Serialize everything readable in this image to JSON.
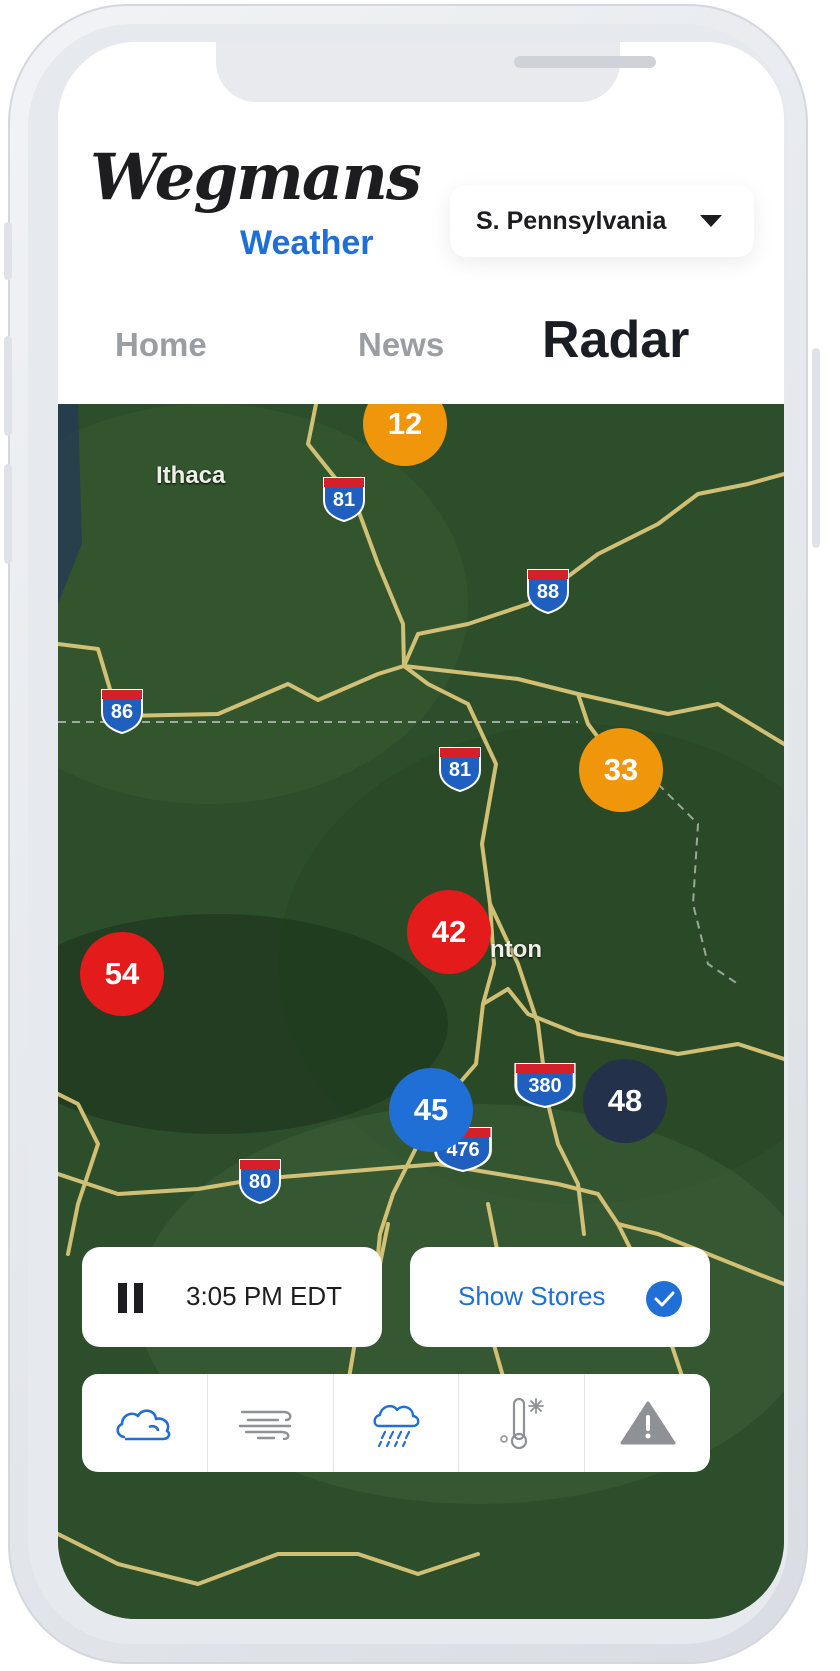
{
  "app": {
    "brand": "Wegmans",
    "brand_sub": "Weather"
  },
  "region_select": {
    "value": "S. Pennsylvania"
  },
  "tabs": [
    {
      "label": "Home"
    },
    {
      "label": "News"
    },
    {
      "label": "Radar",
      "active": true
    }
  ],
  "map": {
    "city": "Ithaca",
    "city_partial": "nton",
    "interstates": [
      "81",
      "88",
      "86",
      "81",
      "380",
      "476",
      "80"
    ],
    "markers": [
      {
        "value": "12",
        "color": "#f0960b"
      },
      {
        "value": "33",
        "color": "#f0960b"
      },
      {
        "value": "42",
        "color": "#e41b1b"
      },
      {
        "value": "54",
        "color": "#e41b1b"
      },
      {
        "value": "45",
        "color": "#1f6fd6"
      },
      {
        "value": "48",
        "color": "#23324a"
      }
    ]
  },
  "playback": {
    "time": "3:05 PM EDT"
  },
  "stores_toggle": {
    "label": "Show Stores",
    "checked": true
  },
  "layer_bar": [
    {
      "icon": "cloud-icon",
      "active": true
    },
    {
      "icon": "wind-icon"
    },
    {
      "icon": "rain-icon"
    },
    {
      "icon": "temperature-snow-icon"
    },
    {
      "icon": "warning-icon"
    }
  ],
  "colors": {
    "accent": "#1f6fd6",
    "text": "#1d1d1f",
    "muted": "#9a9da2"
  }
}
